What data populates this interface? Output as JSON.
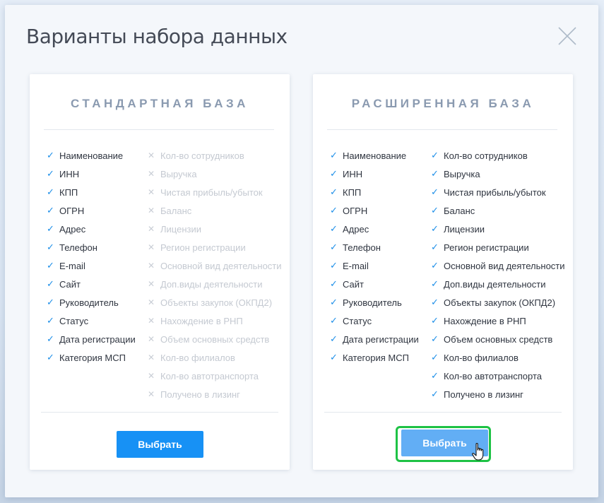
{
  "modal": {
    "title": "Варианты набора данных"
  },
  "cards": {
    "standard": {
      "title": "СТАНДАРТНАЯ БАЗА",
      "col1": [
        "Наименование",
        "ИНН",
        "КПП",
        "ОГРН",
        "Адрес",
        "Телефон",
        "E-mail",
        "Сайт",
        "Руководитель",
        "Статус",
        "Дата регистрации",
        "Категория МСП"
      ],
      "col2": [
        "Кол-во сотрудников",
        "Выручка",
        "Чистая прибыль/убыток",
        "Баланс",
        "Лицензии",
        "Регион регистрации",
        "Основной вид деятельности",
        "Доп.виды деятельности",
        "Объекты закупок (ОКПД2)",
        "Нахождение в РНП",
        "Объем основных средств",
        "Кол-во филиалов",
        "Кол-во автотранспорта",
        "Получено в лизинг"
      ],
      "col2_included": false,
      "button_label": "Выбрать"
    },
    "extended": {
      "title": "РАСШИРЕННАЯ БАЗА",
      "col1": [
        "Наименование",
        "ИНН",
        "КПП",
        "ОГРН",
        "Адрес",
        "Телефон",
        "E-mail",
        "Сайт",
        "Руководитель",
        "Статус",
        "Дата регистрации",
        "Категория МСП"
      ],
      "col2": [
        "Кол-во сотрудников",
        "Выручка",
        "Чистая прибыль/убыток",
        "Баланс",
        "Лицензии",
        "Регион регистрации",
        "Основной вид деятельности",
        "Доп.виды деятельности",
        "Объекты закупок (ОКПД2)",
        "Нахождение в РНП",
        "Объем основных средств",
        "Кол-во филиалов",
        "Кол-во автотранспорта",
        "Получено в лизинг"
      ],
      "col2_included": true,
      "button_label": "Выбрать"
    }
  },
  "icons": {
    "included": "check-icon",
    "excluded": "cross-icon",
    "close": "close-icon",
    "pointer": "hand-pointer-icon"
  },
  "colors": {
    "accent": "#1791f5",
    "accent_hover": "#62aef5",
    "focus_ring": "#1ec245",
    "check": "#1e8fe8",
    "disabled": "#c4c9d1"
  }
}
